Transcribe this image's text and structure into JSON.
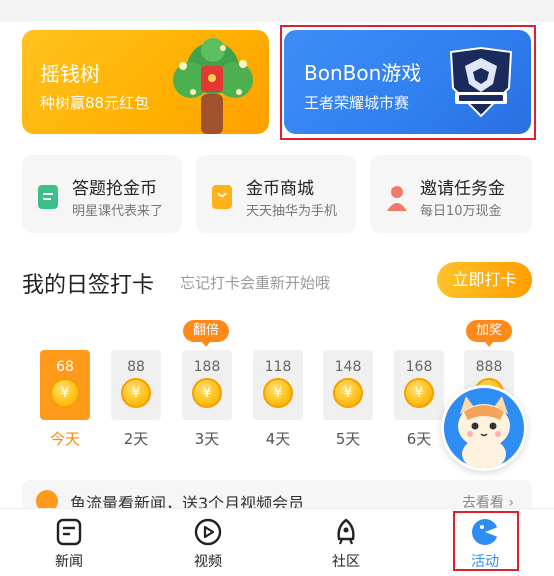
{
  "banners": {
    "tree": {
      "title": "摇钱树",
      "subtitle": "种树赢88元红包"
    },
    "game": {
      "title": "BonBon游戏",
      "subtitle": "王者荣耀城市赛"
    }
  },
  "features": [
    {
      "title": "答题抢金币",
      "subtitle": "明星课代表来了"
    },
    {
      "title": "金币商城",
      "subtitle": "天天抽华为手机"
    },
    {
      "title": "邀请任务金",
      "subtitle": "每日10万现金"
    }
  ],
  "checkin": {
    "title": "我的日签打卡",
    "hint": "忘记打卡会重新开始哦",
    "button": "立即打卡",
    "days": [
      {
        "points": "68",
        "label": "今天"
      },
      {
        "points": "88",
        "label": "2天"
      },
      {
        "points": "188",
        "label": "3天"
      },
      {
        "points": "118",
        "label": "4天"
      },
      {
        "points": "148",
        "label": "5天"
      },
      {
        "points": "168",
        "label": "6天"
      },
      {
        "points": "888",
        "label": ""
      }
    ],
    "tags": {
      "double": "翻倍",
      "bonus": "加奖"
    },
    "coin_symbol": "¥"
  },
  "news_strip": {
    "text": "鱼流量看新闻，送3个月视频会员",
    "more": "去看看 ›"
  },
  "tabbar": {
    "news": "新闻",
    "video": "视频",
    "community": "社区",
    "activity": "活动"
  },
  "colors": {
    "accent": "#ff9a1a",
    "blue": "#2d8df2",
    "highlight": "#e0202a"
  }
}
